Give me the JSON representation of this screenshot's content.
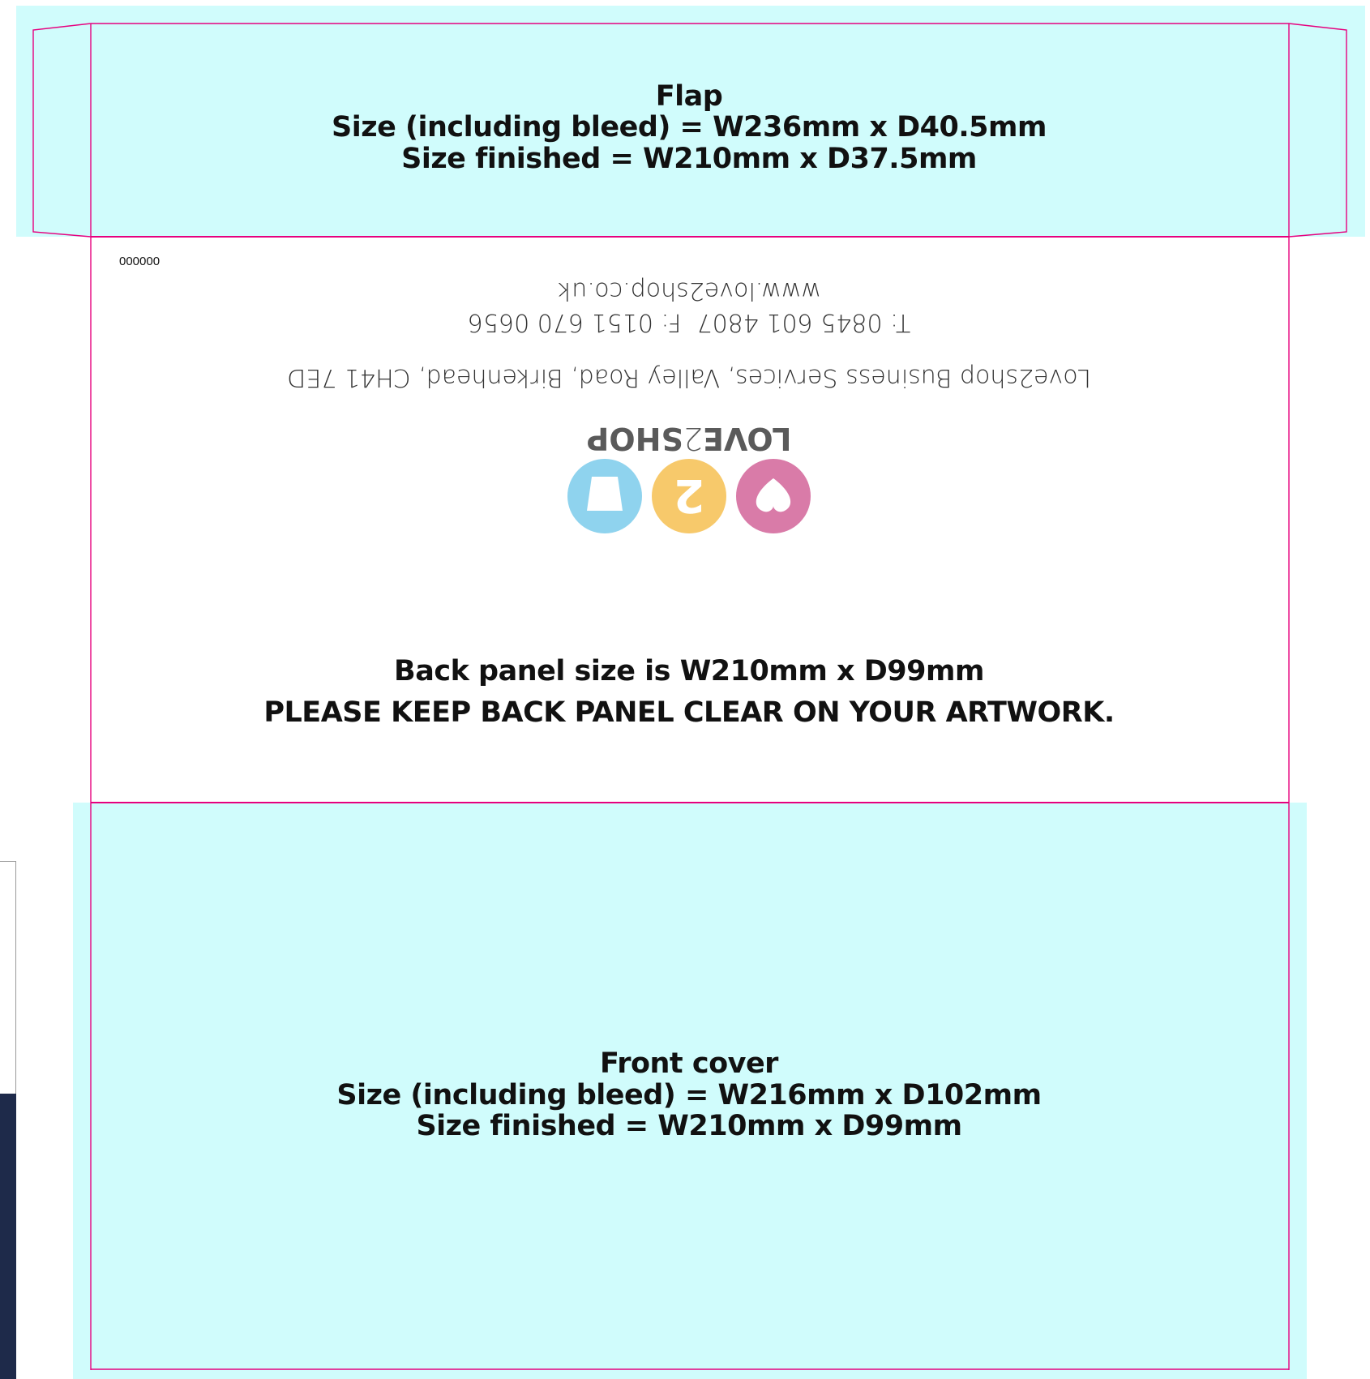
{
  "colors": {
    "bleed_area": "#d0fcfc",
    "guide_line": "#e6007e",
    "logo_heart": "#d97ba8",
    "logo_two": "#f7c96b",
    "logo_bag": "#8fd3ee",
    "logo_text": "#5a5a5a"
  },
  "flap": {
    "title": "Flap",
    "size_bleed": "Size (including bleed) = W236mm x D40.5mm",
    "size_finished": "Size finished = W210mm x D37.5mm"
  },
  "back_panel": {
    "code": "000000",
    "website": "www.love2shop.co.uk",
    "phone": "T: 0845 601 4807  F: 0151 670 0656",
    "address": "Love2shop Business Services, Valley Road, Birkenhead, CH41 7ED",
    "logo": {
      "wordmark_left": "LOVE",
      "wordmark_mid": "2",
      "wordmark_right": "SHOP",
      "icons": [
        "heart-icon",
        "number-two-icon",
        "shopping-bag-icon"
      ]
    },
    "size_note": "Back panel size is W210mm x D99mm",
    "warning": "PLEASE KEEP BACK PANEL CLEAR ON YOUR ARTWORK."
  },
  "front_cover": {
    "title": "Front cover",
    "size_bleed": "Size (including bleed) = W216mm x D102mm",
    "size_finished": "Size finished = W210mm x D99mm"
  }
}
